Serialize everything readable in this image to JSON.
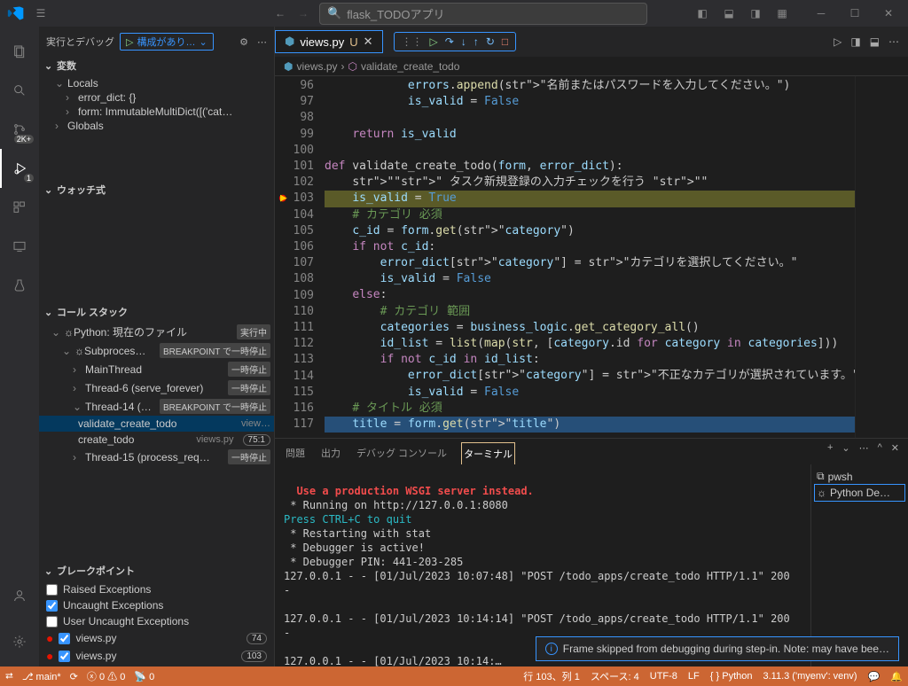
{
  "title_search": "flask_TODOアプリ",
  "sidebar_header": "実行とデバッグ",
  "config_label": "構成があり…",
  "sections": {
    "variables": "変数",
    "locals": "Locals",
    "error_dict": "error_dict: {}",
    "form": "form: ImmutableMultiDict([('cat…",
    "globals": "Globals",
    "watch": "ウォッチ式",
    "callstack": "コール スタック",
    "breakpoints": "ブレークポイント"
  },
  "callstack": {
    "root": "Python: 現在のファイル",
    "root_tag": "実行中",
    "sub": "Subproces…",
    "sub_tag": "BREAKPOINT で一時停止",
    "t_main": "MainThread",
    "t_main_tag": "一時停止",
    "t6": "Thread-6 (serve_forever)",
    "t6_tag": "一時停止",
    "t14": "Thread-14 (…",
    "t14_tag": "BREAKPOINT で一時停止",
    "frame1": "validate_create_todo",
    "frame1_loc": "view…",
    "frame2": "create_todo",
    "frame2_loc": "views.py",
    "frame2_ln": "75:1",
    "t15": "Thread-15 (process_req…",
    "t15_tag": "一時停止"
  },
  "breakpoints": {
    "raised": "Raised Exceptions",
    "uncaught": "Uncaught Exceptions",
    "user_uncaught": "User Uncaught Exceptions",
    "f1": "views.py",
    "f1_ln": "74",
    "f2": "views.py",
    "f2_ln": "103"
  },
  "tab": {
    "name": "views.py",
    "mod": "U"
  },
  "breadcrumb": {
    "file": "views.py",
    "fn": "validate_create_todo"
  },
  "lines": {
    "start": 96,
    "rows": [
      "            errors.append(\"名前またはパスワードを入力してください。\")",
      "            is_valid = False",
      "",
      "    return is_valid",
      "",
      "def validate_create_todo(form, error_dict):",
      "    \"\"\" タスク新規登録の入力チェックを行う \"\"\"",
      "    is_valid = True",
      "    # カテゴリ 必須",
      "    c_id = form.get(\"category\")",
      "    if not c_id:",
      "        error_dict[\"category\"] = \"カテゴリを選択してください。\"",
      "        is_valid = False",
      "    else:",
      "        # カテゴリ 範囲",
      "        categories = business_logic.get_category_all()",
      "        id_list = list(map(str, [category.id for category in categories]))",
      "        if not c_id in id_list:",
      "            error_dict[\"category\"] = \"不正なカテゴリが選択されています。\"",
      "            is_valid = False",
      "    # タイトル 必須",
      "    title = form.get(\"title\")"
    ]
  },
  "panel_tabs": {
    "problems": "問題",
    "output": "出力",
    "debug": "デバッグ コンソール",
    "terminal": "ターミナル"
  },
  "terminal": {
    "l1": "  Use a production WSGI server instead.",
    "l2": " * Running on http://127.0.0.1:8080",
    "l3": "Press CTRL+C to quit",
    "l4": " * Restarting with stat",
    "l5": " * Debugger is active!",
    "l6": " * Debugger PIN: 441-203-285",
    "l7": "127.0.0.1 - - [01/Jul/2023 10:07:48] \"POST /todo_apps/create_todo HTTP/1.1\" 200 -",
    "l8": "127.0.0.1 - - [01/Jul/2023 10:14:14] \"POST /todo_apps/create_todo HTTP/1.1\" 200 -",
    "l9": "127.0.0.1 - - [01/Jul/2023 10:14:…"
  },
  "term_side": {
    "pwsh": "pwsh",
    "py": "Python De…"
  },
  "notification": "Frame skipped from debugging during step-in. Note: may have bee…",
  "status": {
    "remote": "",
    "branch": "main*",
    "errs": "0",
    "warns": "0",
    "port": "0",
    "pos": "行 103、列 1",
    "spaces": "スペース: 4",
    "enc": "UTF-8",
    "eol": "LF",
    "lang": "Python",
    "interp": "3.11.3 ('myenv': venv)"
  }
}
